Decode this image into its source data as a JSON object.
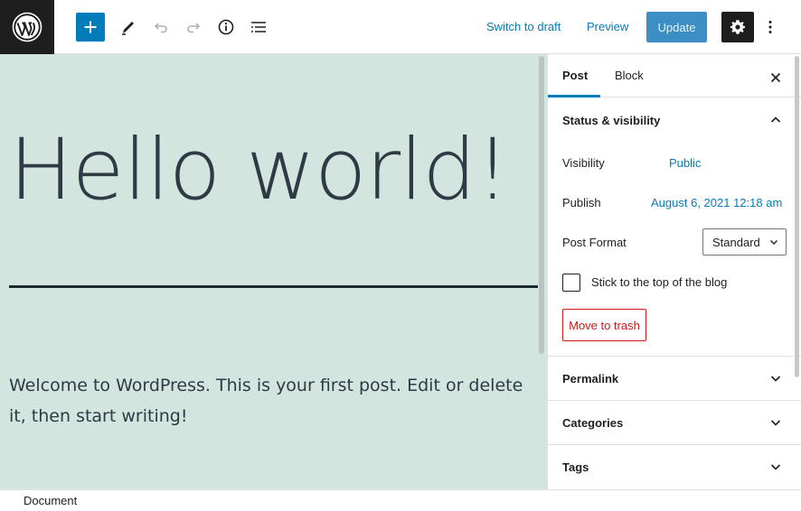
{
  "toolbar": {
    "logo_icon": "wordpress-logo-icon",
    "add_block_icon": "plus-icon",
    "tools_icon": "pencil-icon",
    "undo_icon": "undo-icon",
    "redo_icon": "redo-icon",
    "details_icon": "info-icon",
    "list_view_icon": "list-view-icon",
    "switch_to_draft": "Switch to draft",
    "preview": "Preview",
    "update": "Update",
    "settings_icon": "gear-icon",
    "more_icon": "more-vertical-icon",
    "accent_color": "#007cba"
  },
  "editor": {
    "title": "Hello world!",
    "body": "Welcome to WordPress. This is your first post. Edit or delete it, then start writing!",
    "background_color": "#d3e5df"
  },
  "sidebar": {
    "tabs": [
      {
        "label": "Post",
        "active": true
      },
      {
        "label": "Block",
        "active": false
      }
    ],
    "close_icon": "close-icon",
    "status_panel": {
      "title": "Status & visibility",
      "expanded": true,
      "visibility_label": "Visibility",
      "visibility_value": "Public",
      "publish_label": "Publish",
      "publish_value": "August 6, 2021 12:18 am",
      "format_label": "Post Format",
      "format_value": "Standard",
      "stick_label": "Stick to the top of the blog",
      "stick_checked": false,
      "trash_label": "Move to trash"
    },
    "panels": [
      {
        "title": "Permalink",
        "expanded": false
      },
      {
        "title": "Categories",
        "expanded": false
      },
      {
        "title": "Tags",
        "expanded": false
      }
    ]
  },
  "footer": {
    "breadcrumb": "Document"
  }
}
